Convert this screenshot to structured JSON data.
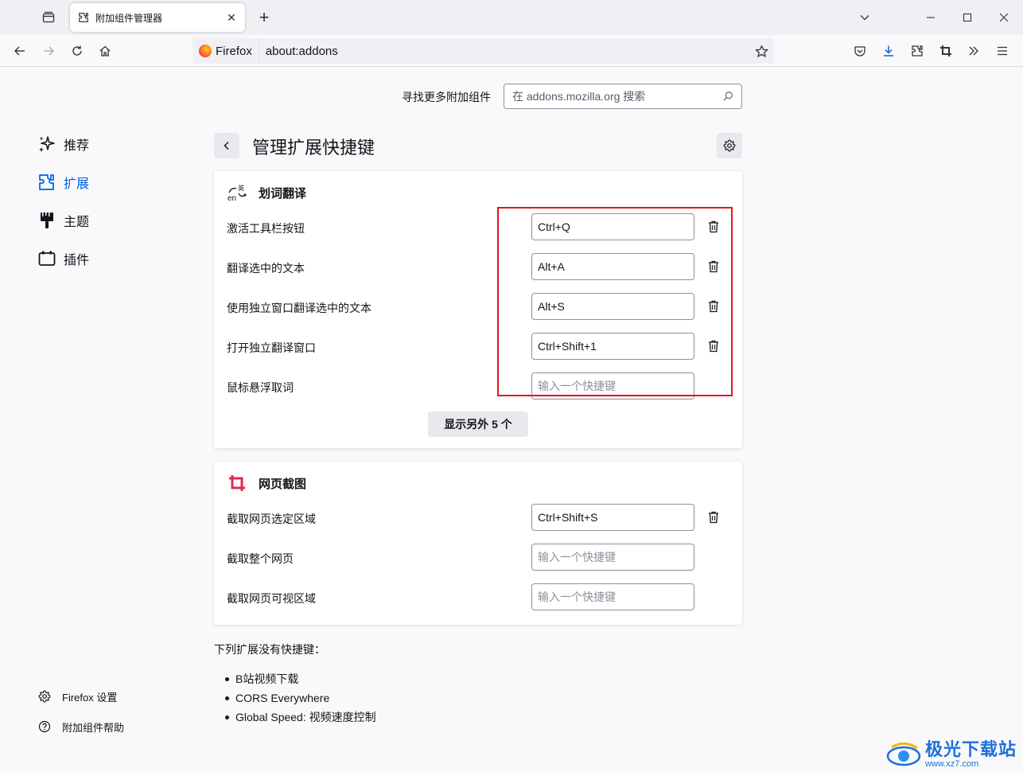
{
  "browser": {
    "tab_title": "附加组件管理器",
    "identity_label": "Firefox",
    "url": "about:addons"
  },
  "search": {
    "label": "寻找更多附加组件",
    "placeholder": "在 addons.mozilla.org 搜索"
  },
  "sidebar": {
    "categories": [
      {
        "label": "推荐",
        "icon": "sparkle-icon"
      },
      {
        "label": "扩展",
        "icon": "puzzle-icon",
        "selected": true
      },
      {
        "label": "主题",
        "icon": "brush-icon"
      },
      {
        "label": "插件",
        "icon": "plugin-icon"
      }
    ],
    "footer": {
      "settings": "Firefox 设置",
      "help": "附加组件帮助"
    }
  },
  "page": {
    "title": "管理扩展快捷键"
  },
  "extensions": [
    {
      "name": "划词翻译",
      "shortcuts": [
        {
          "label": "激活工具栏按钮",
          "value": "Ctrl+Q"
        },
        {
          "label": "翻译选中的文本",
          "value": "Alt+A"
        },
        {
          "label": "使用独立窗口翻译选中的文本",
          "value": "Alt+S"
        },
        {
          "label": "打开独立翻译窗口",
          "value": "Ctrl+Shift+1"
        },
        {
          "label": "鼠标悬浮取词",
          "value": "",
          "placeholder": "输入一个快捷键"
        }
      ],
      "show_more": "显示另外 5 个"
    },
    {
      "name": "网页截图",
      "shortcuts": [
        {
          "label": "截取网页选定区域",
          "value": "Ctrl+Shift+S"
        },
        {
          "label": "截取整个网页",
          "value": "",
          "placeholder": "输入一个快捷键"
        },
        {
          "label": "截取网页可视区域",
          "value": "",
          "placeholder": "输入一个快捷键"
        }
      ]
    }
  ],
  "no_shortcuts": {
    "title": "下列扩展没有快捷键：",
    "items": [
      "B站视频下载",
      "CORS Everywhere",
      "Global Speed: 视频速度控制"
    ]
  },
  "watermark": {
    "cn": "极光下载站",
    "url": "www.xz7.com"
  },
  "colors": {
    "accent": "#0061e0",
    "highlight": "#e3141b",
    "screenshot_icon": "#e22850"
  }
}
